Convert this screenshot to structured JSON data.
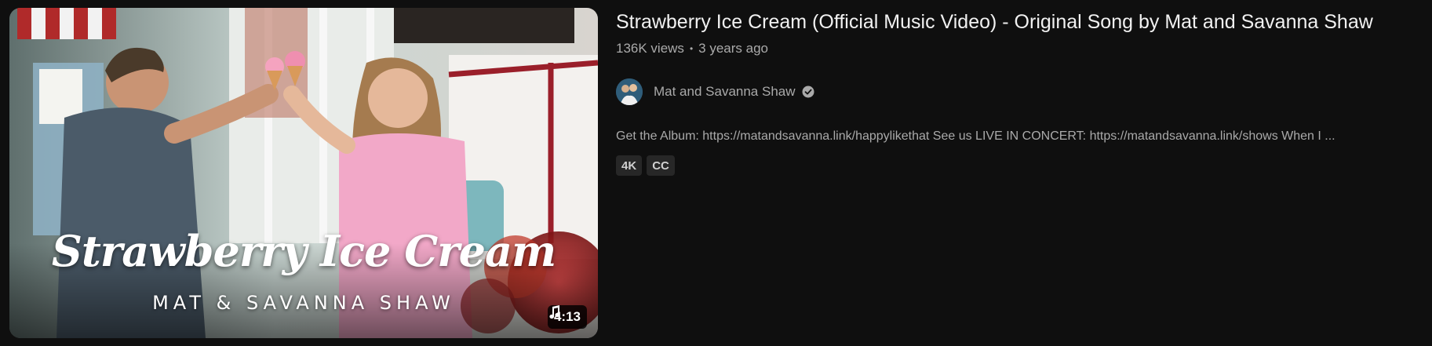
{
  "video": {
    "title": "Strawberry Ice Cream (Official Music Video) - Original Song by Mat and Savanna Shaw",
    "views": "136K views",
    "separator": "•",
    "age": "3 years ago",
    "duration": "4:13",
    "thumbnail": {
      "title_text": "Strawberry Ice Cream",
      "subtitle_text": "MAT & SAVANNA SHAW"
    }
  },
  "channel": {
    "name": "Mat and Savanna Shaw",
    "avatar_icon": "channel-avatar",
    "verified_icon": "verified-icon"
  },
  "description": "Get the Album: https://matandsavanna.link/happylikethat See us LIVE IN CONCERT: https://matandsavanna.link/shows When I ...",
  "badges": [
    "4K",
    "CC"
  ],
  "colors": {
    "background": "#0f0f0f",
    "title": "#f1f1f1",
    "secondary": "#aaaaaa",
    "badge_bg": "#272727"
  }
}
